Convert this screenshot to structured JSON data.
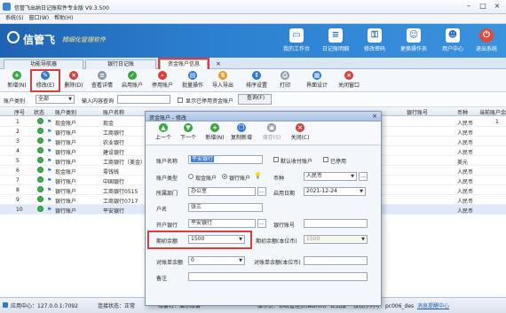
{
  "window": {
    "title": "信管飞出纳日记账软件专业版 V9.3.500"
  },
  "menu": [
    "系统(S)",
    "窗口(W)",
    "帮助(H)"
  ],
  "brand": {
    "name": "信管飞",
    "slogan": "精细化管理软件"
  },
  "top_buttons": [
    "我的工作台",
    "日记账明细",
    "修改密码",
    "更换操作员",
    "用户中心",
    "退出系统"
  ],
  "tabs": [
    "功能导航器",
    "银行日记账",
    "资金账户信息"
  ],
  "toolbar": [
    "新增(N)",
    "修改(E)",
    "删除(D)",
    "查看详情",
    "启用账户",
    "停用账户",
    "批量操作",
    "导入导出",
    "排序设置",
    "打印",
    "界面设计",
    "关闭窗口"
  ],
  "filter": {
    "type_label": "账户类别",
    "type_value": "全部",
    "query_label": "输入内容查询",
    "show_disabled": "显示已停用资金账户",
    "query_button": "查询(F)"
  },
  "grid": {
    "headers": [
      "序号",
      "状态",
      "账户类别",
      "账户名称",
      "银行账号",
      "币种",
      "当前账户余额"
    ],
    "rows": [
      {
        "no": "1",
        "type": "现金账户",
        "name": "现金",
        "currency": "人民币",
        "balance": "1"
      },
      {
        "no": "2",
        "type": "银行账户",
        "name": "工商银行",
        "currency": "人民币",
        "balance": ""
      },
      {
        "no": "3",
        "type": "银行账户",
        "name": "农业银行",
        "currency": "人民币",
        "balance": ""
      },
      {
        "no": "4",
        "type": "银行账户",
        "name": "建设银行",
        "currency": "人民币",
        "balance": ""
      },
      {
        "no": "5",
        "type": "银行账户",
        "name": "工商银行（美金）",
        "currency": "美元",
        "balance": ""
      },
      {
        "no": "6",
        "type": "现金账户",
        "name": "零钱钱",
        "currency": "人民币",
        "balance": ""
      },
      {
        "no": "7",
        "type": "银行账户",
        "name": "中国银行",
        "currency": "人民币",
        "balance": ""
      },
      {
        "no": "8",
        "type": "银行账户",
        "name": "工商银行0515",
        "currency": "人民币",
        "balance": ""
      },
      {
        "no": "9",
        "type": "银行账户",
        "name": "工商银行0717",
        "currency": "人民币",
        "balance": ""
      },
      {
        "no": "10",
        "type": "银行账户",
        "name": "平安银行",
        "currency": "人民币",
        "balance": ""
      }
    ]
  },
  "dialog": {
    "title": "资金账户 - 修改",
    "tools": [
      "上一个",
      "下一个",
      "新增(N)",
      "复制新增",
      "保存(S)",
      "关闭(C)"
    ],
    "account_name_label": "账户名称",
    "account_name_value": "平安银行",
    "default_collect_label": "默认收付账户",
    "disabled_label": "已停用",
    "account_type_label": "账户类型",
    "cash_label": "现金账户",
    "bank_label": "银行账户",
    "currency_label": "币种",
    "currency_value": "人民币",
    "dept_label": "所属部门",
    "dept_value": "办公室",
    "start_date_label": "启用日期",
    "start_date_value": "2021-12-24",
    "holder_label": "户名",
    "holder_value": "张三",
    "bank_open_label": "开户银行",
    "bank_open_value": "平安银行",
    "bank_no_label": "银行账号",
    "opening_label": "期初余额",
    "opening_value": "1500",
    "opening_local_label": "期初余额(本位币)",
    "opening_local_value": "1500",
    "recon_label": "对账单余额",
    "recon_value": "0",
    "recon_local_label": "对账单余额(本位币)",
    "remark_label": "备注"
  },
  "status": {
    "server": "应用中心：127.0.0.1:7092",
    "connect": "连接状态：正常",
    "account_set": "账套名：演示账套",
    "operator": "操作员：系统管理员(admin)",
    "edition": "正式版",
    "license": "授权序列号：pc006_des",
    "message": "消息提醒中心"
  }
}
